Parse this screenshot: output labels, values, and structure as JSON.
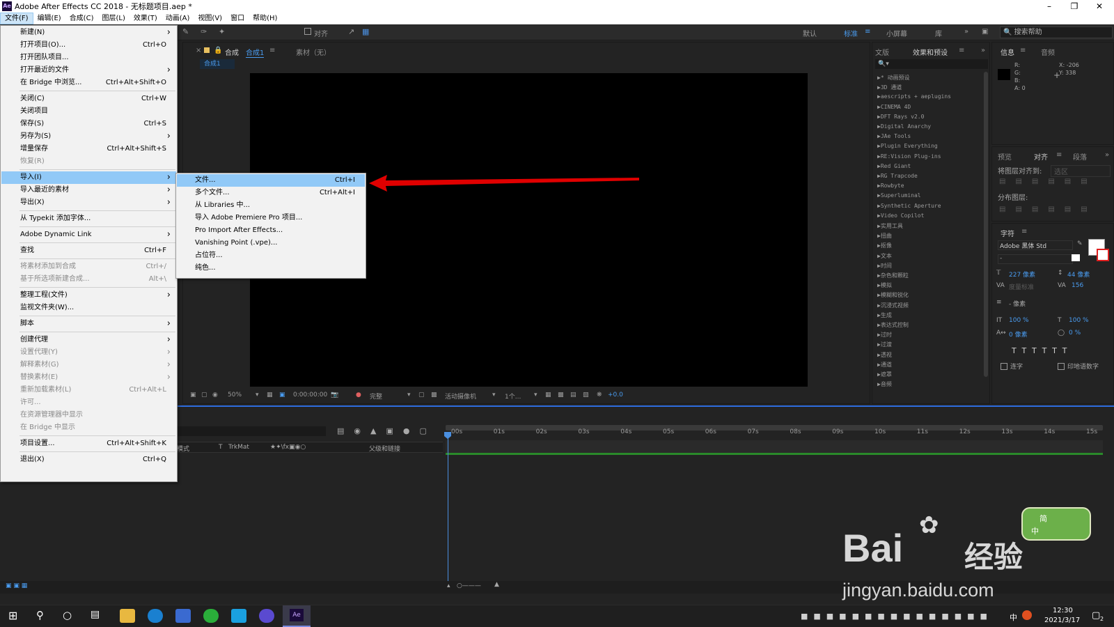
{
  "window": {
    "title": "Adobe After Effects CC 2018 - 无标题项目.aep *",
    "app_icon": "Ae"
  },
  "menubar": [
    "文件(F)",
    "编辑(E)",
    "合成(C)",
    "图层(L)",
    "效果(T)",
    "动画(A)",
    "视图(V)",
    "窗口",
    "帮助(H)"
  ],
  "toolbar": {
    "align_label": "对齐",
    "workspaces": [
      "默认",
      "标准",
      "小屏幕",
      "库"
    ],
    "active_workspace": "标准",
    "help_placeholder": "搜索帮助"
  },
  "comp_panel": {
    "tab_label": "合成",
    "tab_name": "合成1",
    "footage_tab": "素材（无）",
    "breadcrumb": "合成1",
    "zoom": "50%",
    "timecode": "0:00:00:00",
    "resolution": "完整",
    "camera": "活动摄像机",
    "views": "1个...",
    "exposure": "+0.0"
  },
  "effects_panel": {
    "tabs": [
      "文版",
      "效果和预设"
    ],
    "categories": [
      "* 动画预设",
      "3D 通道",
      "aescripts + aeplugins",
      "CINEMA 4D",
      "DFT Rays v2.0",
      "Digital Anarchy",
      "JAe Tools",
      "Plugin Everything",
      "RE:Vision Plug-ins",
      "Red Giant",
      "RG Trapcode",
      "Rowbyte",
      "Superluminal",
      "Synthetic Aperture",
      "Video Copilot",
      "实用工具",
      "扭曲",
      "抠像",
      "文本",
      "时间",
      "杂色和颗粒",
      "模拟",
      "模糊和锐化",
      "沉浸式视频",
      "生成",
      "表达式控制",
      "过时",
      "过渡",
      "透视",
      "通道",
      "遮罩",
      "音频"
    ]
  },
  "info_panel": {
    "tabs": [
      "信息",
      "音频"
    ],
    "r": "R:",
    "g": "G:",
    "b": "B:",
    "a": "A: 0",
    "x": "X: -206",
    "y": "Y: 338"
  },
  "align_panel": {
    "tabs": [
      "预览",
      "对齐",
      "段落"
    ],
    "align_to_label": "将图层对齐到:",
    "align_to_value": "选区",
    "distribute_label": "分布图层:"
  },
  "char_panel": {
    "tab": "字符",
    "font": "Adobe 黑体 Std",
    "style": "-",
    "size": "227 像素",
    "leading": "44 像素",
    "kerning": "度量标准",
    "tracking": "156",
    "stroke": "- 像素",
    "vscale": "100 %",
    "hscale": "100 %",
    "baseline": "0 像素",
    "tsume": "0 %",
    "ligatures": "连字",
    "hindi_digits": "印地语数字"
  },
  "timeline": {
    "col_mode": "模式",
    "col_t": "T",
    "col_trkmat": "TrkMat",
    "col_parent": "父级和链接",
    "ruler": [
      "00s",
      "01s",
      "02s",
      "03s",
      "04s",
      "05s",
      "06s",
      "07s",
      "08s",
      "09s",
      "10s",
      "11s",
      "12s",
      "13s",
      "14s",
      "15s"
    ]
  },
  "file_menu": [
    {
      "label": "新建(N)",
      "shortcut": "",
      "arrow": true,
      "disabled": false
    },
    {
      "label": "打开项目(O)...",
      "shortcut": "Ctrl+O",
      "arrow": false,
      "disabled": false
    },
    {
      "label": "打开团队项目...",
      "shortcut": "",
      "arrow": false,
      "disabled": false
    },
    {
      "label": "打开最近的文件",
      "shortcut": "",
      "arrow": true,
      "disabled": false
    },
    {
      "label": "在 Bridge 中浏览...",
      "shortcut": "Ctrl+Alt+Shift+O",
      "arrow": false,
      "disabled": false
    },
    {
      "sep": true
    },
    {
      "label": "关闭(C)",
      "shortcut": "Ctrl+W",
      "arrow": false,
      "disabled": false
    },
    {
      "label": "关闭项目",
      "shortcut": "",
      "arrow": false,
      "disabled": false
    },
    {
      "label": "保存(S)",
      "shortcut": "Ctrl+S",
      "arrow": false,
      "disabled": false
    },
    {
      "label": "另存为(S)",
      "shortcut": "",
      "arrow": true,
      "disabled": false
    },
    {
      "label": "增量保存",
      "shortcut": "Ctrl+Alt+Shift+S",
      "arrow": false,
      "disabled": false
    },
    {
      "label": "恢复(R)",
      "shortcut": "",
      "arrow": false,
      "disabled": true
    },
    {
      "sep": true
    },
    {
      "label": "导入(I)",
      "shortcut": "",
      "arrow": true,
      "disabled": false,
      "highlight": true
    },
    {
      "label": "导入最近的素材",
      "shortcut": "",
      "arrow": true,
      "disabled": false
    },
    {
      "label": "导出(X)",
      "shortcut": "",
      "arrow": true,
      "disabled": false
    },
    {
      "sep": true
    },
    {
      "label": "从 Typekit 添加字体...",
      "shortcut": "",
      "arrow": false,
      "disabled": false
    },
    {
      "sep": true
    },
    {
      "label": "Adobe Dynamic Link",
      "shortcut": "",
      "arrow": true,
      "disabled": false
    },
    {
      "sep": true
    },
    {
      "label": "查找",
      "shortcut": "Ctrl+F",
      "arrow": false,
      "disabled": false
    },
    {
      "sep": true
    },
    {
      "label": "将素材添加到合成",
      "shortcut": "Ctrl+/",
      "arrow": false,
      "disabled": true
    },
    {
      "label": "基于所选项新建合成...",
      "shortcut": "Alt+\\",
      "arrow": false,
      "disabled": true
    },
    {
      "sep": true
    },
    {
      "label": "整理工程(文件)",
      "shortcut": "",
      "arrow": true,
      "disabled": false
    },
    {
      "label": "监视文件夹(W)...",
      "shortcut": "",
      "arrow": false,
      "disabled": false
    },
    {
      "sep": true
    },
    {
      "label": "脚本",
      "shortcut": "",
      "arrow": true,
      "disabled": false
    },
    {
      "sep": true
    },
    {
      "label": "创建代理",
      "shortcut": "",
      "arrow": true,
      "disabled": false
    },
    {
      "label": "设置代理(Y)",
      "shortcut": "",
      "arrow": true,
      "disabled": true
    },
    {
      "label": "解释素材(G)",
      "shortcut": "",
      "arrow": true,
      "disabled": true
    },
    {
      "label": "替换素材(E)",
      "shortcut": "",
      "arrow": true,
      "disabled": true
    },
    {
      "label": "重新加载素材(L)",
      "shortcut": "Ctrl+Alt+L",
      "arrow": false,
      "disabled": true
    },
    {
      "label": "许可...",
      "shortcut": "",
      "arrow": false,
      "disabled": true
    },
    {
      "label": "在资源管理器中显示",
      "shortcut": "",
      "arrow": false,
      "disabled": true
    },
    {
      "label": "在 Bridge 中显示",
      "shortcut": "",
      "arrow": false,
      "disabled": true
    },
    {
      "sep": true
    },
    {
      "label": "项目设置...",
      "shortcut": "Ctrl+Alt+Shift+K",
      "arrow": false,
      "disabled": false
    },
    {
      "sep": true
    },
    {
      "label": "退出(X)",
      "shortcut": "Ctrl+Q",
      "arrow": false,
      "disabled": false
    }
  ],
  "import_submenu": [
    {
      "label": "文件...",
      "shortcut": "Ctrl+I",
      "highlight": true
    },
    {
      "label": "多个文件...",
      "shortcut": "Ctrl+Alt+I"
    },
    {
      "label": "从 Libraries 中...",
      "shortcut": ""
    },
    {
      "label": "导入 Adobe Premiere Pro 项目...",
      "shortcut": ""
    },
    {
      "label": "Pro Import After Effects...",
      "shortcut": ""
    },
    {
      "label": "Vanishing Point (.vpe)...",
      "shortcut": ""
    },
    {
      "label": "占位符...",
      "shortcut": ""
    },
    {
      "label": "纯色...",
      "shortcut": ""
    }
  ],
  "taskbar": {
    "time": "12:30",
    "date": "2021/3/17",
    "ime": "中",
    "notif_count": "2"
  },
  "watermark": {
    "brand": "Bai",
    "brand2": "经验",
    "url": "jingyan.baidu.com",
    "ime_badge_top": "简",
    "ime_badge_bottom": "中"
  },
  "colors": {
    "menu_highlight": "#91c9f7",
    "accent_blue": "#2d6cdf",
    "arrow_red": "#e00000",
    "panel_bg": "#232323"
  }
}
